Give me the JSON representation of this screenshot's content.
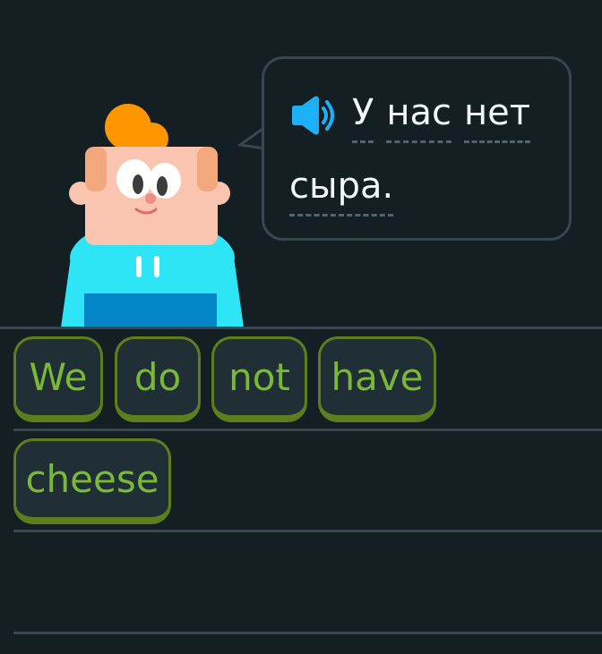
{
  "prompt": {
    "words": [
      "У",
      "нас",
      "нет",
      "сыра."
    ],
    "speaker_icon": "speaker-icon"
  },
  "answer_tiles": [
    "We",
    "do",
    "not",
    "have",
    "cheese"
  ],
  "colors": {
    "background": "#141f24",
    "bubble_border": "#37464f",
    "tile_border": "#5e7e1e",
    "tile_text": "#79b933",
    "tile_fill": "#202f36",
    "speaker_blue": "#1cb0f6"
  }
}
